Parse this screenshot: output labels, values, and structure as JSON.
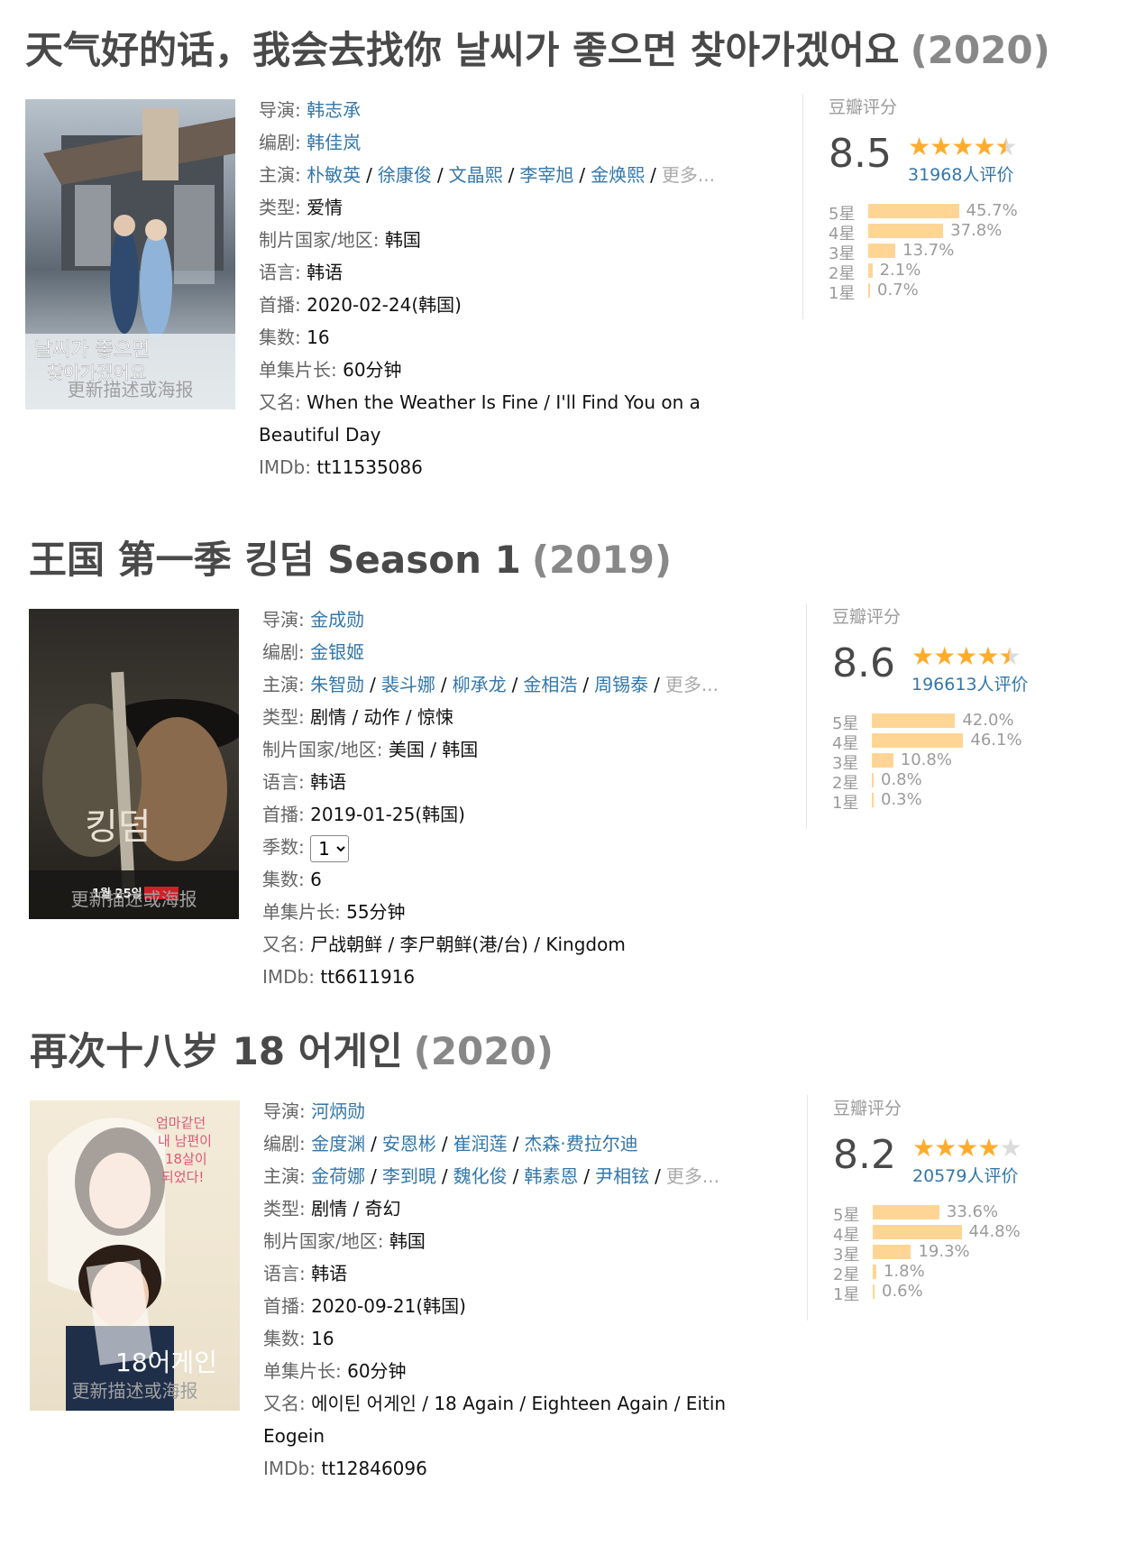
{
  "entries": [
    {
      "title": "天气好的话，我会去找你 날씨가 좋으면 찾아가겠어요",
      "year": "(2020)",
      "poster_update": "更新描述或海报",
      "director_label": "导演",
      "directors": [
        "韩志承"
      ],
      "writer_label": "编剧",
      "writers": [
        "韩佳岚"
      ],
      "cast_label": "主演",
      "cast": [
        "朴敏英",
        "徐康俊",
        "文晶熙",
        "李宰旭",
        "金焕熙"
      ],
      "more": "更多...",
      "genre_label": "类型",
      "genre": "爱情",
      "country_label": "制片国家/地区",
      "country": "韩国",
      "language_label": "语言",
      "language": "韩语",
      "premiere_label": "首播",
      "premiere": "2020-02-24(韩国)",
      "episodes_label": "集数",
      "episodes": "16",
      "runtime_label": "单集片长",
      "runtime": "60分钟",
      "aka_label": "又名",
      "aka": "When the Weather Is Fine / I'll Find You on a Beautiful Day",
      "imdb_label": "IMDb",
      "imdb": "tt11535086",
      "rating_label": "豆瓣评分",
      "score": "8.5",
      "stars": 4.5,
      "votes": "31968人评价",
      "dist": [
        {
          "label": "5星",
          "pct": 45.7,
          "text": "45.7%"
        },
        {
          "label": "4星",
          "pct": 37.8,
          "text": "37.8%"
        },
        {
          "label": "3星",
          "pct": 13.7,
          "text": "13.7%"
        },
        {
          "label": "2星",
          "pct": 2.1,
          "text": "2.1%"
        },
        {
          "label": "1星",
          "pct": 0.7,
          "text": "0.7%"
        }
      ]
    },
    {
      "title": "王国 第一季 킹덤 Season 1",
      "year": "(2019)",
      "poster_update": "更新描述或海报",
      "director_label": "导演",
      "directors": [
        "金成勋"
      ],
      "writer_label": "编剧",
      "writers": [
        "金银姬"
      ],
      "cast_label": "主演",
      "cast": [
        "朱智勋",
        "裴斗娜",
        "柳承龙",
        "金相浩",
        "周锡泰"
      ],
      "more": "更多...",
      "genre_label": "类型",
      "genre": "剧情 / 动作 / 惊悚",
      "country_label": "制片国家/地区",
      "country": "美国 / 韩国",
      "language_label": "语言",
      "language": "韩语",
      "premiere_label": "首播",
      "premiere": "2019-01-25(韩国)",
      "season_label": "季数",
      "season": "1",
      "episodes_label": "集数",
      "episodes": "6",
      "runtime_label": "单集片长",
      "runtime": "55分钟",
      "aka_label": "又名",
      "aka": "尸战朝鲜 / 李尸朝鲜(港/台) / Kingdom",
      "imdb_label": "IMDb",
      "imdb": "tt6611916",
      "rating_label": "豆瓣评分",
      "score": "8.6",
      "stars": 4.5,
      "votes": "196613人评价",
      "dist": [
        {
          "label": "5星",
          "pct": 42.0,
          "text": "42.0%"
        },
        {
          "label": "4星",
          "pct": 46.1,
          "text": "46.1%"
        },
        {
          "label": "3星",
          "pct": 10.8,
          "text": "10.8%"
        },
        {
          "label": "2星",
          "pct": 0.8,
          "text": "0.8%"
        },
        {
          "label": "1星",
          "pct": 0.3,
          "text": "0.3%"
        }
      ]
    },
    {
      "title": "再次十八岁 18 어게인",
      "year": "(2020)",
      "poster_update": "更新描述或海报",
      "director_label": "导演",
      "directors": [
        "河炳勋"
      ],
      "writer_label": "编剧",
      "writers": [
        "金度渊",
        "安恩彬",
        "崔润莲",
        "杰森·费拉尔迪"
      ],
      "cast_label": "主演",
      "cast": [
        "金荷娜",
        "李到晛",
        "魏化俊",
        "韩素恩",
        "尹相铉"
      ],
      "more": "更多...",
      "genre_label": "类型",
      "genre": "剧情 / 奇幻",
      "country_label": "制片国家/地区",
      "country": "韩国",
      "language_label": "语言",
      "language": "韩语",
      "premiere_label": "首播",
      "premiere": "2020-09-21(韩国)",
      "episodes_label": "集数",
      "episodes": "16",
      "runtime_label": "单集片长",
      "runtime": "60分钟",
      "aka_label": "又名",
      "aka": "에이틴 어게인 / 18 Again / Eighteen Again / Eitin Eogein",
      "imdb_label": "IMDb",
      "imdb": "tt12846096",
      "rating_label": "豆瓣评分",
      "score": "8.2",
      "stars": 4,
      "votes": "20579人评价",
      "dist": [
        {
          "label": "5星",
          "pct": 33.6,
          "text": "33.6%"
        },
        {
          "label": "4星",
          "pct": 44.8,
          "text": "44.8%"
        },
        {
          "label": "3星",
          "pct": 19.3,
          "text": "19.3%"
        },
        {
          "label": "2星",
          "pct": 1.8,
          "text": "1.8%"
        },
        {
          "label": "1星",
          "pct": 0.6,
          "text": "0.6%"
        }
      ]
    }
  ],
  "poster_art": [
    {
      "text_lines": [
        "날씨가 좋으면",
        "찾아가겠어요"
      ]
    },
    {
      "text_lines": [
        "킹덤",
        "1월 25일"
      ]
    },
    {
      "text_lines": [
        "엄마같던",
        "내 남편이",
        "18살이",
        "되었다!",
        "18어게인"
      ]
    }
  ],
  "colors": {
    "link": "#3377aa",
    "star": "#ffac2d",
    "bar": "#ffd596",
    "title": "#494949"
  }
}
